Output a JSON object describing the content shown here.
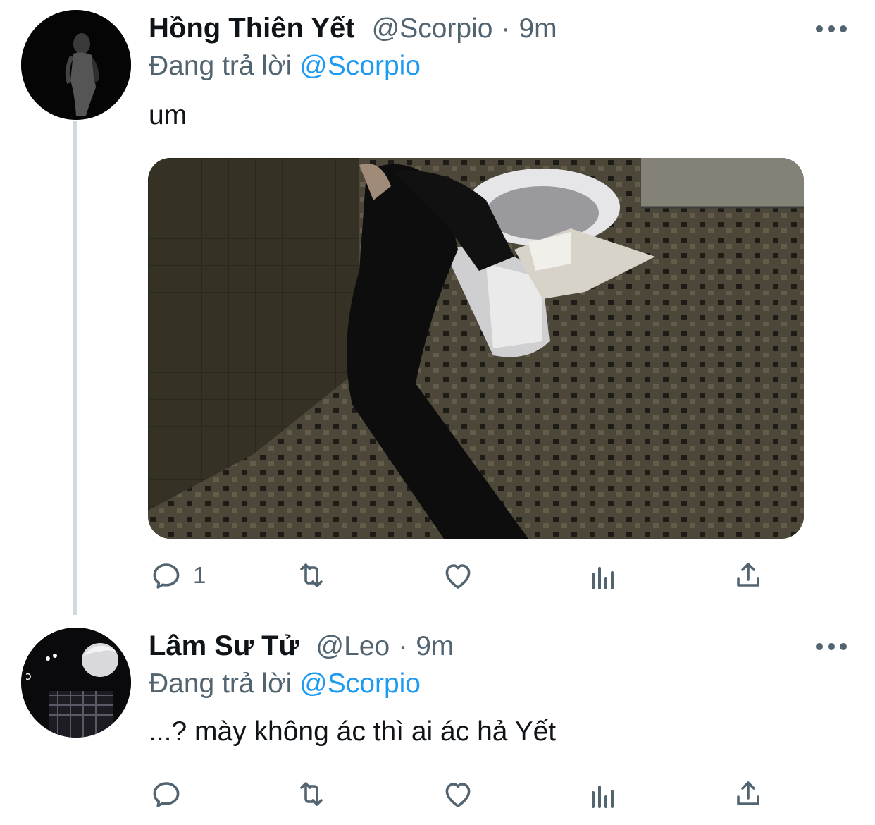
{
  "tweets": [
    {
      "name": "Hồng Thiên Yết",
      "handle": "@Scorpio",
      "separator": "·",
      "time": "9m",
      "replying_prefix": "Đang trả lời",
      "replying_to": "@Scorpio",
      "text": "um",
      "actions": {
        "reply_count": "1",
        "retweet_count": "",
        "like_count": ""
      }
    },
    {
      "name": "Lâm Sư Tử",
      "handle": "@Leo",
      "separator": "·",
      "time": "9m",
      "replying_prefix": "Đang trả lời",
      "replying_to": "@Scorpio",
      "text": "...? mày không ác thì ai ác hả Yết",
      "actions": {
        "reply_count": "",
        "retweet_count": "",
        "like_count": ""
      }
    }
  ],
  "icons": [
    "more-icon",
    "reply-icon",
    "retweet-icon",
    "like-icon",
    "analytics-icon",
    "share-icon"
  ],
  "colors": {
    "text": "#0f1419",
    "secondary": "#536471",
    "link": "#1d9bf0",
    "thread_line": "#cfd9de"
  }
}
